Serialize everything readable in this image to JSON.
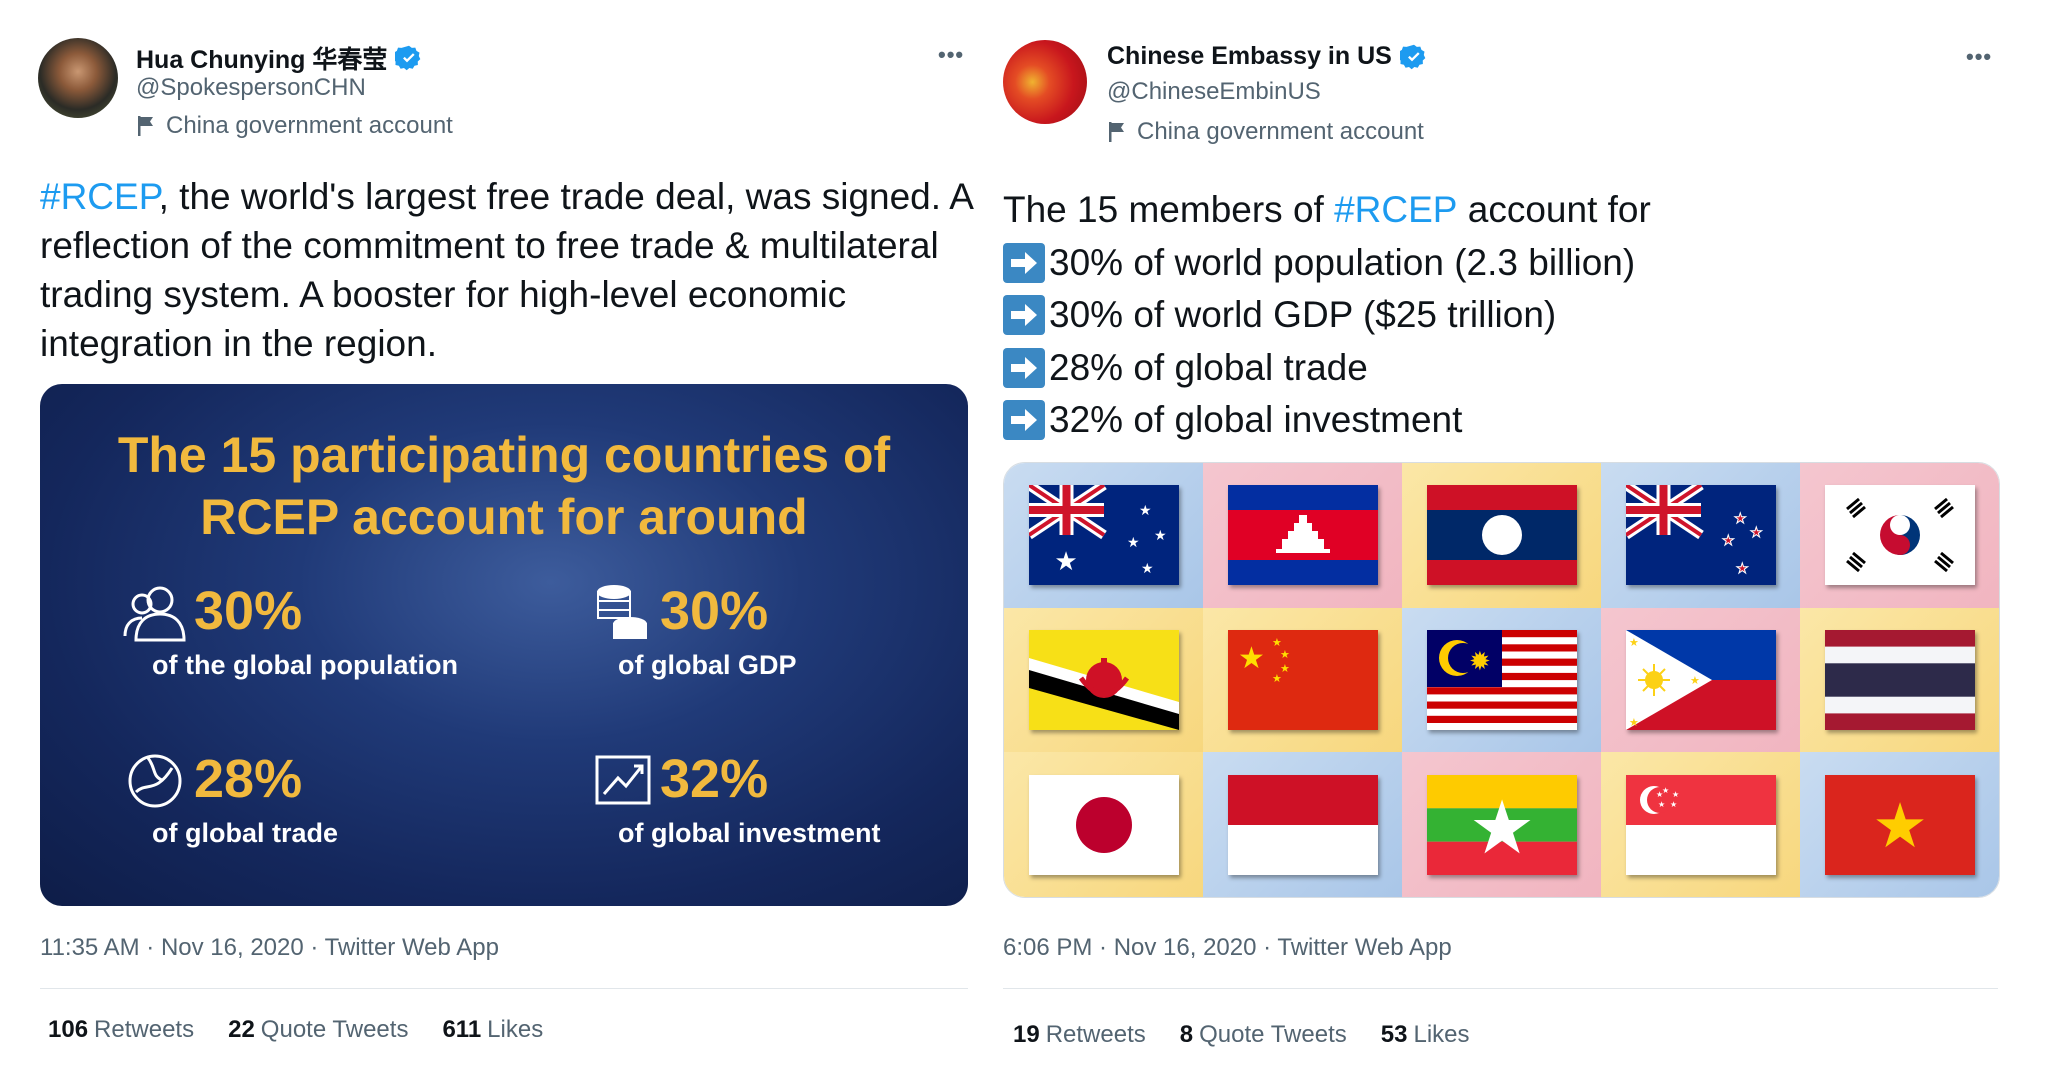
{
  "tweet1": {
    "author_name": "Hua Chunying 华春莹",
    "handle": "@SpokespersonCHN",
    "account_label": "China government account",
    "text_hashtag": "#RCEP",
    "text_rest": ", the world's largest free trade deal, was signed. A reflection of the commitment to free trade & multilateral trading system. A booster for high-level economic integration in the region.",
    "media": {
      "title_line1": "The 15 participating countries of",
      "title_line2": "RCEP account for around",
      "stats": [
        {
          "value": "30%",
          "label": "of the global population",
          "icon": "people-icon"
        },
        {
          "value": "30%",
          "label": "of global GDP",
          "icon": "coins-icon"
        },
        {
          "value": "28%",
          "label": "of global trade",
          "icon": "globe-icon"
        },
        {
          "value": "32%",
          "label": "of global investment",
          "icon": "trend-chart-icon"
        }
      ]
    },
    "timestamp": "11:35 AM · Nov 16, 2020 · Twitter Web App",
    "retweets_count": "106",
    "retweets_label": "Retweets",
    "quote_count": "22",
    "quote_label": "Quote Tweets",
    "likes_count": "611",
    "likes_label": "Likes"
  },
  "tweet2": {
    "author_name": "Chinese Embassy in US",
    "handle": "@ChineseEmbinUS",
    "account_label": "China government account",
    "intro_prefix": "The 15 members of ",
    "intro_hashtag": "#RCEP",
    "intro_suffix": " account for",
    "bullets": [
      "30% of world population (2.3 billion)",
      "30% of world GDP ($25 trillion)",
      "28% of global trade",
      "32% of global investment"
    ],
    "flags": [
      "australia",
      "cambodia",
      "laos",
      "new-zealand",
      "south-korea",
      "brunei",
      "china",
      "malaysia",
      "philippines",
      "thailand",
      "japan",
      "indonesia",
      "myanmar",
      "singapore",
      "vietnam"
    ],
    "timestamp": "6:06 PM · Nov 16, 2020 · Twitter Web App",
    "retweets_count": "19",
    "retweets_label": "Retweets",
    "quote_count": "8",
    "quote_label": "Quote Tweets",
    "likes_count": "53",
    "likes_label": "Likes"
  },
  "more_icon": "•••",
  "colors": {
    "hashtag": "#1d9bf0",
    "verified": "#1d9bf0",
    "gold_text": "#f1b93e",
    "arrow_box": "#3b88c3"
  }
}
